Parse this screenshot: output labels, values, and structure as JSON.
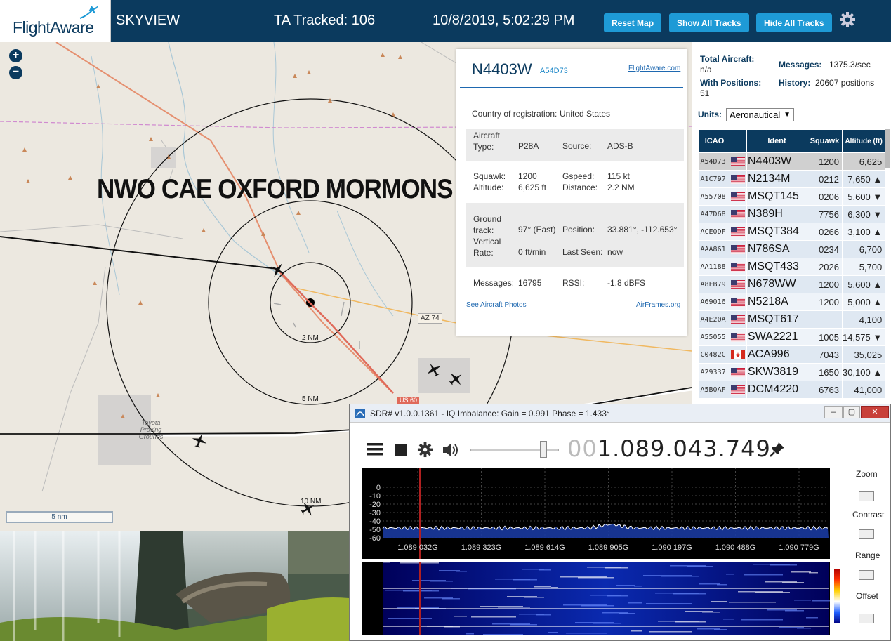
{
  "topbar": {
    "logo_text": "FlightAware",
    "site_name": "SKYVIEW",
    "ta_tracked": "TA Tracked: 106",
    "datetime": "10/8/2019, 5:02:29 PM",
    "reset_map": "Reset Map",
    "show_all_tracks": "Show All Tracks",
    "hide_all_tracks": "Hide All Tracks"
  },
  "map": {
    "zoom_in": "+",
    "zoom_out": "−",
    "overlay_title": "NWO CAE OXFORD MORMONS",
    "ring_2nm": "2 NM",
    "ring_5nm": "5 NM",
    "ring_10nm": "10 NM",
    "road_az74": "AZ 74",
    "road_us60": "US 60",
    "place_label": "Toyota Proving Grounds",
    "scale_label": "5 nm"
  },
  "aircraft_info": {
    "registration": "N4403W",
    "hex": "A54D73",
    "flightaware_link": "FlightAware.com",
    "country_label": "Country of registration:",
    "country_value": "United States",
    "type_label": "Aircraft Type:",
    "type_value": "P28A",
    "source_label": "Source:",
    "source_value": "ADS-B",
    "squawk_label": "Squawk:",
    "squawk_value": "1200",
    "gspeed_label": "Gspeed:",
    "gspeed_value": "115 kt",
    "altitude_label": "Altitude:",
    "altitude_value": "6,625 ft",
    "distance_label": "Distance:",
    "distance_value": "2.2 NM",
    "track_label": "Ground track:",
    "track_value": "97° (East)",
    "position_label": "Position:",
    "position_value": "33.881°, -112.653°",
    "vrate_label": "Vertical Rate:",
    "vrate_value": "0 ft/min",
    "lastseen_label": "Last Seen:",
    "lastseen_value": "now",
    "messages_label": "Messages:",
    "messages_value": "16795",
    "rssi_label": "RSSI:",
    "rssi_value": "-1.8 dBFS",
    "photos_link": "See Aircraft Photos",
    "airframes_link": "AirFrames.org"
  },
  "stats": {
    "total_label": "Total Aircraft:",
    "total_value": "n/a",
    "messages_label": "Messages:",
    "messages_value": "1375.3/sec",
    "positions_label": "With Positions:",
    "positions_value": "51",
    "history_label": "History:",
    "history_value": "20607 positions",
    "units_label": "Units:",
    "units_value": "Aeronautical"
  },
  "table": {
    "headers": [
      "ICAO",
      "",
      "Ident",
      "Squawk",
      "Altitude (ft)"
    ],
    "rows": [
      {
        "icao": "A54D73",
        "flag": "us",
        "ident": "N4403W",
        "squawk": "1200",
        "alt": "6,625"
      },
      {
        "icao": "A1C797",
        "flag": "us",
        "ident": "N2134M",
        "squawk": "0212",
        "alt": "7,650 ▲"
      },
      {
        "icao": "A55708",
        "flag": "us",
        "ident": "MSQT145",
        "squawk": "0206",
        "alt": "5,600 ▼"
      },
      {
        "icao": "A47D68",
        "flag": "us",
        "ident": "N389H",
        "squawk": "7756",
        "alt": "6,300 ▼"
      },
      {
        "icao": "ACE0DF",
        "flag": "us",
        "ident": "MSQT384",
        "squawk": "0266",
        "alt": "3,100 ▲"
      },
      {
        "icao": "AAA861",
        "flag": "us",
        "ident": "N786SA",
        "squawk": "0234",
        "alt": "6,700"
      },
      {
        "icao": "AA1188",
        "flag": "us",
        "ident": "MSQT433",
        "squawk": "2026",
        "alt": "5,700"
      },
      {
        "icao": "A8FB79",
        "flag": "us",
        "ident": "N678WW",
        "squawk": "1200",
        "alt": "5,600 ▲"
      },
      {
        "icao": "A69016",
        "flag": "us",
        "ident": "N5218A",
        "squawk": "1200",
        "alt": "5,000 ▲"
      },
      {
        "icao": "A4E20A",
        "flag": "us",
        "ident": "MSQT617",
        "squawk": "",
        "alt": "4,100"
      },
      {
        "icao": "A55055",
        "flag": "us",
        "ident": "SWA2221",
        "squawk": "1005",
        "alt": "14,575 ▼"
      },
      {
        "icao": "C0482C",
        "flag": "ca",
        "ident": "ACA996",
        "squawk": "7043",
        "alt": "35,025"
      },
      {
        "icao": "A29337",
        "flag": "us",
        "ident": "SKW3819",
        "squawk": "1650",
        "alt": "30,100 ▲"
      },
      {
        "icao": "A5B0AF",
        "flag": "us",
        "ident": "DCM4220",
        "squawk": "6763",
        "alt": "41,000"
      }
    ]
  },
  "sdr": {
    "title": "SDR# v1.0.0.1361 - IQ Imbalance: Gain = 0.991 Phase = 1.433°",
    "freq_dim": "00",
    "freq_main": "1.089.043.749",
    "db_ticks": [
      "0",
      "-10",
      "-20",
      "-30",
      "-40",
      "-50",
      "-60"
    ],
    "freq_ticks": [
      "1.089 032G",
      "1.089 323G",
      "1.089 614G",
      "1.089 905G",
      "1.090 197G",
      "1.090 488G",
      "1.090 779G"
    ],
    "zoom_label": "Zoom",
    "contrast_label": "Contrast",
    "range_label": "Range",
    "offset_label": "Offset"
  },
  "colors": {
    "header_bg": "#0b3a5e",
    "button": "#1e9ad6",
    "link": "#1e68b0"
  }
}
